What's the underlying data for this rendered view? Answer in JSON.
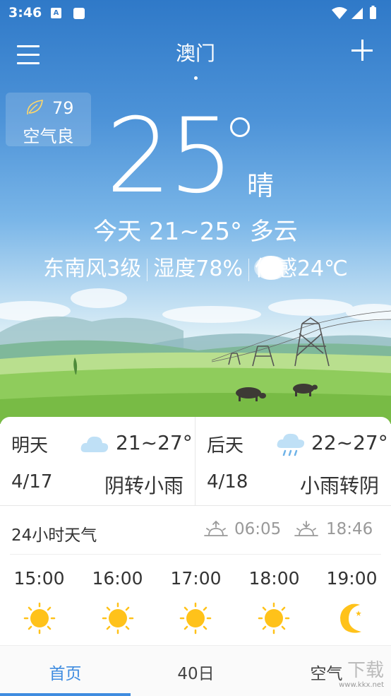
{
  "status_bar": {
    "time": "3:46",
    "notif_letter": "A"
  },
  "header": {
    "city": "澳门"
  },
  "aqi": {
    "value": "79",
    "label": "空气良"
  },
  "current": {
    "temp": "25",
    "condition": "晴",
    "summary": "今天 21~25° 多云",
    "wind": "东南风3级",
    "humidity": "湿度78%",
    "feels": "体感24℃"
  },
  "forecast": {
    "tomorrow": {
      "label": "明天",
      "temp": "21~27°",
      "date": "4/17",
      "desc": "阴转小雨",
      "icon": "cloud-icon"
    },
    "day_after": {
      "label": "后天",
      "temp": "22~27°",
      "date": "4/18",
      "desc": "小雨转阴",
      "icon": "rain-cloud-icon"
    }
  },
  "hourly": {
    "title": "24小时天气",
    "sunrise": "06:05",
    "sunset": "18:46",
    "hours": [
      {
        "time": "15:00",
        "icon": "sun-icon"
      },
      {
        "time": "16:00",
        "icon": "sun-icon"
      },
      {
        "time": "17:00",
        "icon": "sun-icon"
      },
      {
        "time": "18:00",
        "icon": "sun-icon"
      },
      {
        "time": "19:00",
        "icon": "moon-icon"
      }
    ]
  },
  "tabs": [
    {
      "label": "首页",
      "active": true
    },
    {
      "label": "40日",
      "active": false
    },
    {
      "label": "空气",
      "active": false
    }
  ],
  "watermark": {
    "text": "下载",
    "url": "www.kkx.net"
  },
  "colors": {
    "accent": "#3f8ce0",
    "sun": "#ffb300",
    "sky_top": "#2f79c8"
  }
}
